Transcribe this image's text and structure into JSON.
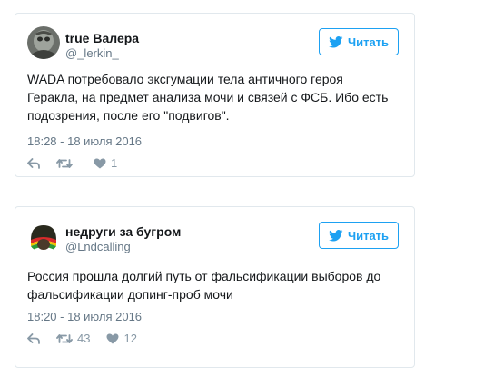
{
  "tweets": [
    {
      "display_name": "true Валера",
      "handle": "@_lerkin_",
      "follow_label": "Читать",
      "text": "WADA потребовало эксгумации тела античного героя\nГеракла, на предмет анализа мочи и связей с ФСБ. Ибо есть\nподозрения, после его \"подвигов\".",
      "timestamp": "18:28 - 18 июля 2016",
      "reply_icon": "reply-icon",
      "retweet_icon": "retweet-icon",
      "retweet_count": "",
      "like_icon": "heart-icon",
      "like_count": "1"
    },
    {
      "display_name": "недруги за бугром",
      "handle": "@Lndcalling",
      "follow_label": "Читать",
      "text": "Россия прошла долгий путь от фальсификации выборов до\nфальсификации допинг-проб мочи",
      "timestamp": "18:20 - 18 июля 2016",
      "reply_icon": "reply-icon",
      "retweet_icon": "retweet-icon",
      "retweet_count": "43",
      "like_icon": "heart-icon",
      "like_count": "12"
    }
  ],
  "colors": {
    "accent": "#1da1f2",
    "text": "#14171a",
    "muted": "#657786",
    "border": "#e1e8ed"
  }
}
